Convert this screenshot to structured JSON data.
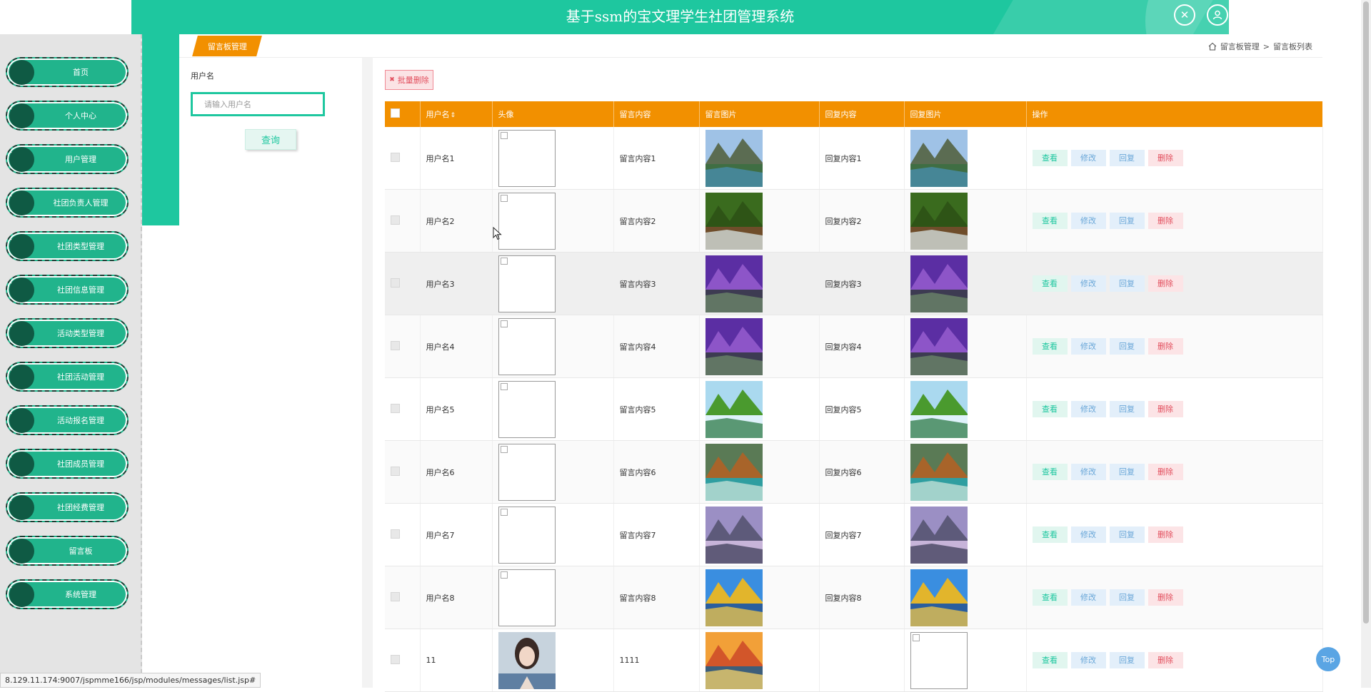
{
  "header": {
    "title": "基于ssm的宝文理学生社团管理系统"
  },
  "sidebar": {
    "items": [
      {
        "label": "首页"
      },
      {
        "label": "个人中心"
      },
      {
        "label": "用户管理"
      },
      {
        "label": "社团负责人管理"
      },
      {
        "label": "社团类型管理"
      },
      {
        "label": "社团信息管理"
      },
      {
        "label": "活动类型管理"
      },
      {
        "label": "社团活动管理"
      },
      {
        "label": "活动报名管理"
      },
      {
        "label": "社团成员管理"
      },
      {
        "label": "社团经费管理"
      },
      {
        "label": "留言板"
      },
      {
        "label": "系统管理"
      }
    ]
  },
  "tab": {
    "label": "留言板管理"
  },
  "breadcrumb": {
    "item1": "留言板管理",
    "sep": ">",
    "item2": "留言板列表"
  },
  "search": {
    "label": "用户名",
    "placeholder": "请输入用户名",
    "button": "查询"
  },
  "batch_delete": "批量删除",
  "table": {
    "headers": [
      "用户名",
      "头像",
      "留言内容",
      "留言图片",
      "回复内容",
      "回复图片",
      "操作"
    ],
    "sort_icon": "⇕",
    "actions": {
      "view": "查看",
      "edit": "修改",
      "reply": "回复",
      "delete": "删除"
    },
    "rows": [
      {
        "username": "用户名1",
        "content": "留言内容1",
        "reply": "回复内容1",
        "image": "mountain-lake-photo"
      },
      {
        "username": "用户名2",
        "content": "留言内容2",
        "reply": "回复内容2",
        "image": "forest-waterfall-photo"
      },
      {
        "username": "用户名3",
        "content": "留言内容3",
        "reply": "回复内容3",
        "image": "purple-coast-photo"
      },
      {
        "username": "用户名4",
        "content": "留言内容4",
        "reply": "回复内容4",
        "image": "purple-coast-photo"
      },
      {
        "username": "用户名5",
        "content": "留言内容5",
        "reply": "回复内容5",
        "image": "green-waterfall-photo"
      },
      {
        "username": "用户名6",
        "content": "留言内容6",
        "reply": "回复内容6",
        "image": "autumn-waterfall-photo"
      },
      {
        "username": "用户名7",
        "content": "留言内容7",
        "reply": "回复内容7",
        "image": "misty-mountain-photo"
      },
      {
        "username": "用户名8",
        "content": "留言内容8",
        "reply": "回复内容8",
        "image": "golden-peak-lake-photo"
      },
      {
        "username": "11",
        "content": "1111",
        "reply": "",
        "image": "sunset-harbor-photo"
      }
    ]
  },
  "status_url": "8.129.11.174:9007/jspmme166/jsp/modules/messages/list.jsp#",
  "top_button": "Top",
  "colors": {
    "primary": "#1ec79f",
    "orange": "#f29000",
    "menu": "#21b48c",
    "danger": "#e24e5d"
  }
}
